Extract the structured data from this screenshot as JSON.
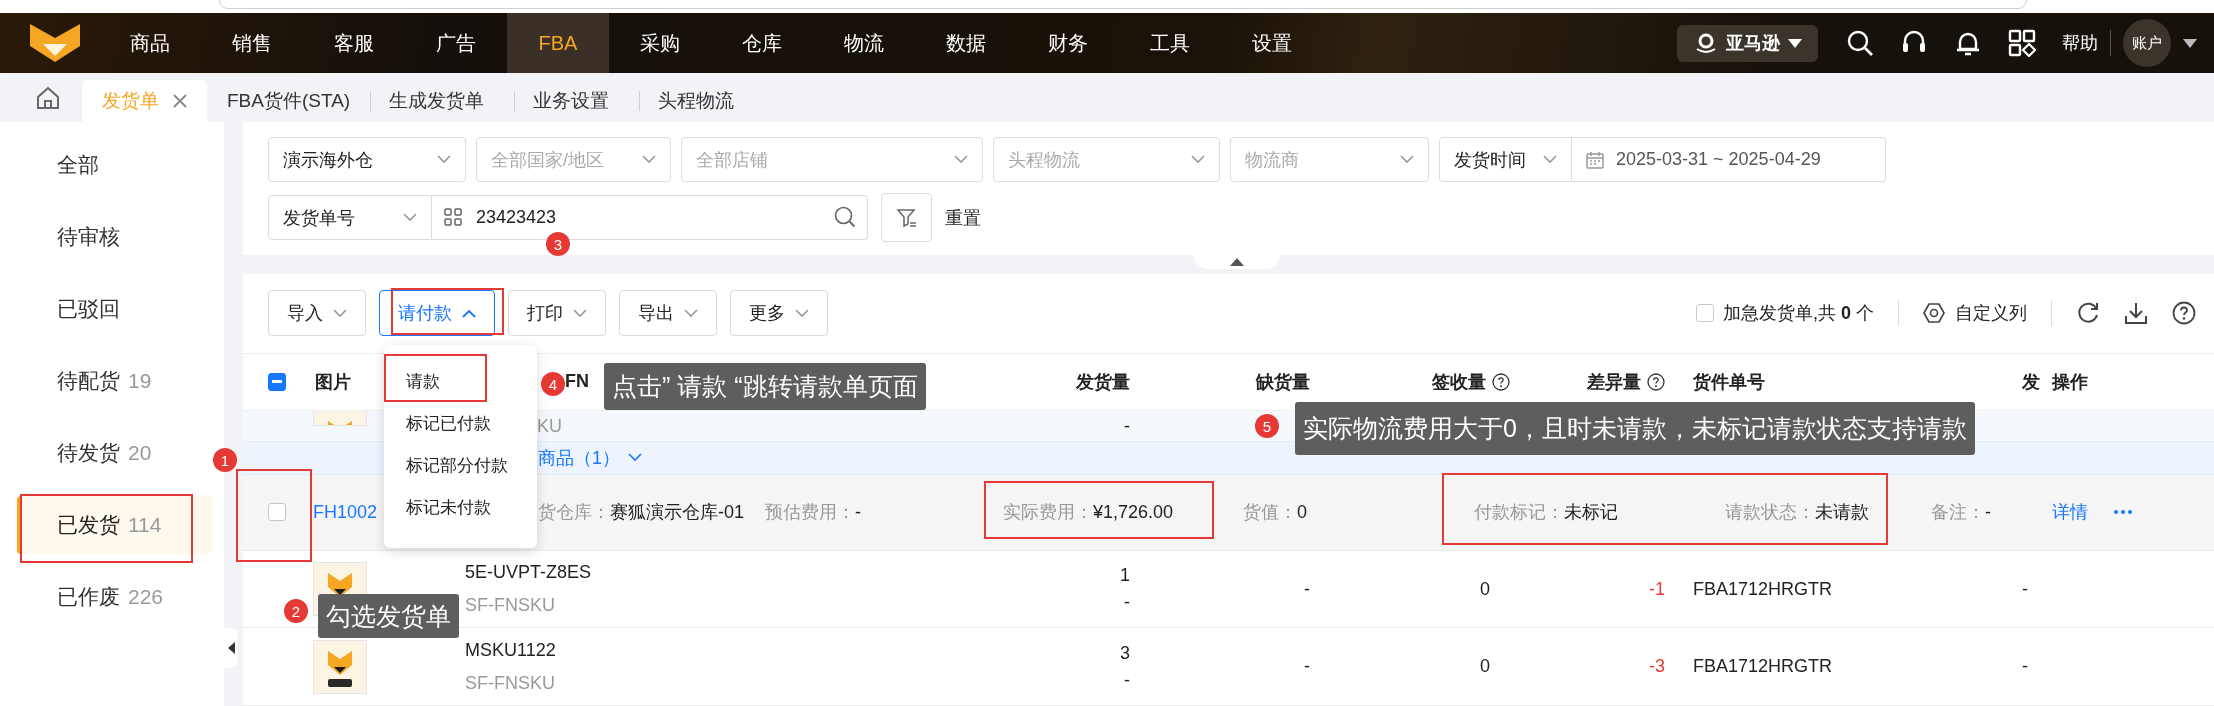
{
  "nav": {
    "items": [
      {
        "label": "商品",
        "selected": false
      },
      {
        "label": "销售",
        "selected": false
      },
      {
        "label": "客服",
        "selected": false
      },
      {
        "label": "广告",
        "selected": false
      },
      {
        "label": "FBA",
        "selected": true
      },
      {
        "label": "采购",
        "selected": false
      },
      {
        "label": "仓库",
        "selected": false
      },
      {
        "label": "物流",
        "selected": false
      },
      {
        "label": "数据",
        "selected": false
      },
      {
        "label": "财务",
        "selected": false
      },
      {
        "label": "工具",
        "selected": false
      },
      {
        "label": "设置",
        "selected": false
      }
    ],
    "platform": "亚马逊",
    "help": "帮助",
    "account": "账户"
  },
  "page_tabs": [
    {
      "label": "发货单",
      "selected": true,
      "closable": true
    },
    {
      "label": "FBA货件(STA)",
      "selected": false,
      "closable": false
    },
    {
      "label": "生成发货单",
      "selected": false,
      "closable": false
    },
    {
      "label": "业务设置",
      "selected": false,
      "closable": false
    },
    {
      "label": "头程物流",
      "selected": false,
      "closable": false
    }
  ],
  "sidebar": {
    "items": [
      {
        "label": "全部",
        "selected": false
      },
      {
        "label": "待审核",
        "selected": false
      },
      {
        "label": "已驳回",
        "selected": false
      },
      {
        "label": "待配货",
        "count": "19",
        "selected": false
      },
      {
        "label": "待发货",
        "count": "20",
        "selected": false
      },
      {
        "label": "已发货",
        "count": "114",
        "selected": true
      },
      {
        "label": "已作废",
        "count": "226",
        "selected": false
      }
    ]
  },
  "filters": {
    "row_1": [
      {
        "kind": "select",
        "value": "演示海外仓"
      },
      {
        "kind": "select",
        "placeholder": "全部国家/地区"
      },
      {
        "kind": "select",
        "placeholder": "全部店铺"
      },
      {
        "kind": "select",
        "placeholder": "头程物流"
      },
      {
        "kind": "select",
        "placeholder": "物流商"
      },
      {
        "kind": "date_range",
        "type": "发货时间",
        "value": "2025-03-31 ~ 2025-04-29"
      }
    ],
    "search": {
      "type": "发货单号",
      "value": "23423423"
    },
    "reset": "重置"
  },
  "toolbar": {
    "buttons": [
      {
        "label": "导入",
        "open": false
      },
      {
        "label": "请付款",
        "open": true
      },
      {
        "label": "打印",
        "open": false
      },
      {
        "label": "导出",
        "open": false
      },
      {
        "label": "更多",
        "open": false
      }
    ],
    "urgent": {
      "label": "加急发货单,共 **0** 个",
      "checked": false
    },
    "custom_columns": "自定义列"
  },
  "menu": {
    "items": [
      "请款",
      "标记已付款",
      "标记部分付款",
      "标记未付款"
    ]
  },
  "table": {
    "header_checkbox_partial": true,
    "columns": [
      {
        "label": "图片",
        "help": false
      },
      {
        "label": "FN",
        "help": false
      },
      {
        "label": "发货量",
        "help": false
      },
      {
        "label": "缺货量",
        "help": false
      },
      {
        "label": "签收量",
        "help": true
      },
      {
        "label": "差异量",
        "help": true
      },
      {
        "label": "货件单号",
        "help": false
      },
      {
        "label": "发",
        "help": false
      },
      {
        "label": "操作",
        "help": false
      }
    ],
    "sub_row": {
      "product": "KU",
      "quantity": "-"
    },
    "group": {
      "label": "商品（1）"
    },
    "order": {
      "selected": false,
      "number": "FH1002",
      "fields": [
        {
          "label": "货仓库：",
          "value": "赛狐演示仓库-01"
        },
        {
          "label": "预估费用：",
          "value": "-"
        },
        {
          "label": "实际费用：",
          "value": "¥1,726.00"
        },
        {
          "label": "货值：",
          "value": "0"
        },
        {
          "label": "付款标记：",
          "value": "未标记"
        },
        {
          "label": "请款状态：",
          "value": "未请款"
        },
        {
          "label": "备注：",
          "value": "-"
        }
      ],
      "action": "详情"
    },
    "items": [
      {
        "sku": "5E-UVPT-Z8ES",
        "fnsku": "SF-FNSKU",
        "quantity": "1",
        "quantity_sub": "-",
        "shortage": "-",
        "received": "0",
        "difference": "-1",
        "negative": true,
        "shipment": "FBA1712HRGTR",
        "column_8": "-"
      },
      {
        "sku": "MSKU1122",
        "fnsku": "SF-FNSKU",
        "quantity": "3",
        "quantity_sub": "-",
        "shortage": "-",
        "received": "0",
        "difference": "-3",
        "negative": true,
        "shipment": "FBA1712HRGTR",
        "column_8": "-"
      }
    ]
  },
  "annotations": {
    "badges": [
      "1",
      "2",
      "3",
      "4",
      "5"
    ],
    "tooltips": [
      "点击” 请款 “跳转请款单页面",
      "勾选发货单",
      "实际物流费用大于0，且时未请款，未标记请款状态支持请款"
    ]
  }
}
